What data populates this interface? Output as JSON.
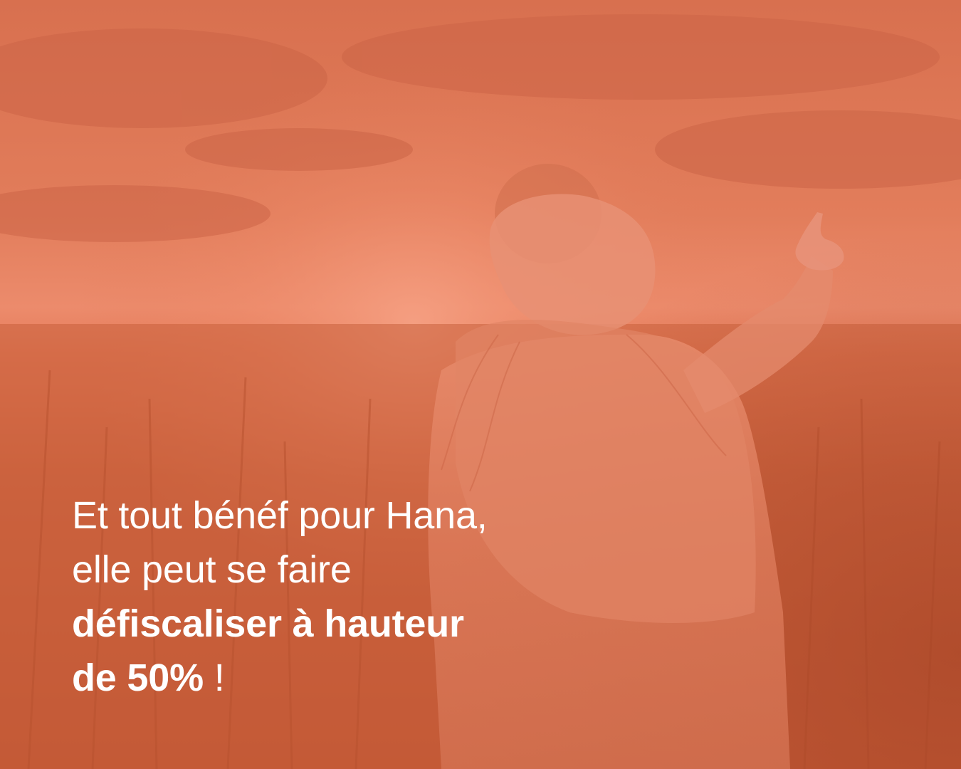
{
  "image": {
    "description_icon": "mother-carrying-child-sunset-photo",
    "overlay_color": "#e8714c"
  },
  "caption": {
    "line1": "Et tout bénéf pour Hana,",
    "line2": "elle peut se faire",
    "line3_bold": "défiscaliser à hauteur",
    "line4_bold": "de 50%",
    "line4_tail": " !"
  }
}
